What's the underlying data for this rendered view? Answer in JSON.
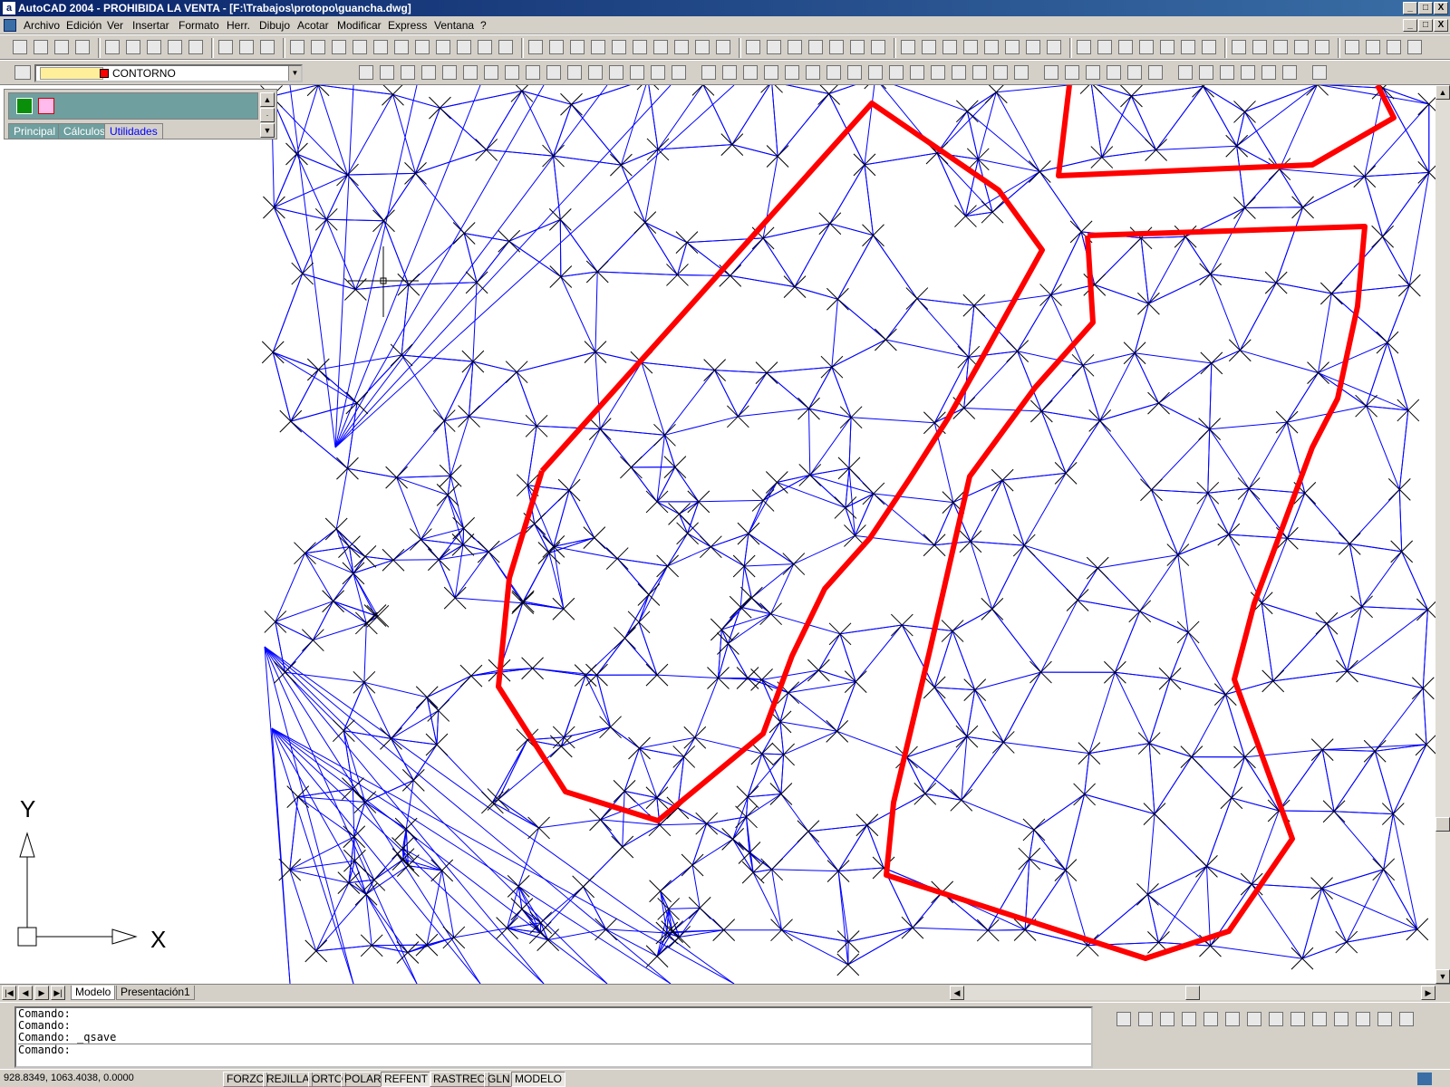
{
  "window": {
    "title": "AutoCAD 2004 - PROHIBIDA LA VENTA - [F:\\Trabajos\\protopo\\guancha.dwg]",
    "buttons": [
      "_",
      "□",
      "X"
    ]
  },
  "menu": [
    "Archivo",
    "Edición",
    "Ver",
    "Insertar",
    "Formato",
    "Herr.",
    "Dibujo",
    "Acotar",
    "Modificar",
    "Express",
    "Ventana",
    "?"
  ],
  "layer": {
    "name": "CONTORNO",
    "color": "#ff0000"
  },
  "panel": {
    "tabs": [
      "Principal",
      "Cálculos",
      "Utilidades"
    ],
    "active": "Utilidades"
  },
  "layout_tabs": [
    "Modelo",
    "Presentación1"
  ],
  "command_lines": [
    "Comando:",
    "Comando:",
    "Comando: _qsave",
    "Comando:"
  ],
  "status": {
    "coords": "928.8349, 1063.4038, 0.0000",
    "toggles": [
      "FORZC",
      "REJILLA",
      "ORTO",
      "POLAR",
      "REFENT",
      "RASTREO",
      "GLN",
      "MODELO"
    ],
    "active": [
      "REFENT",
      "MODELO"
    ]
  },
  "ucs": {
    "x": "X",
    "y": "Y"
  },
  "colors": {
    "mesh": "#0000ff",
    "contour": "#ff0000",
    "title": "#0a246a"
  }
}
